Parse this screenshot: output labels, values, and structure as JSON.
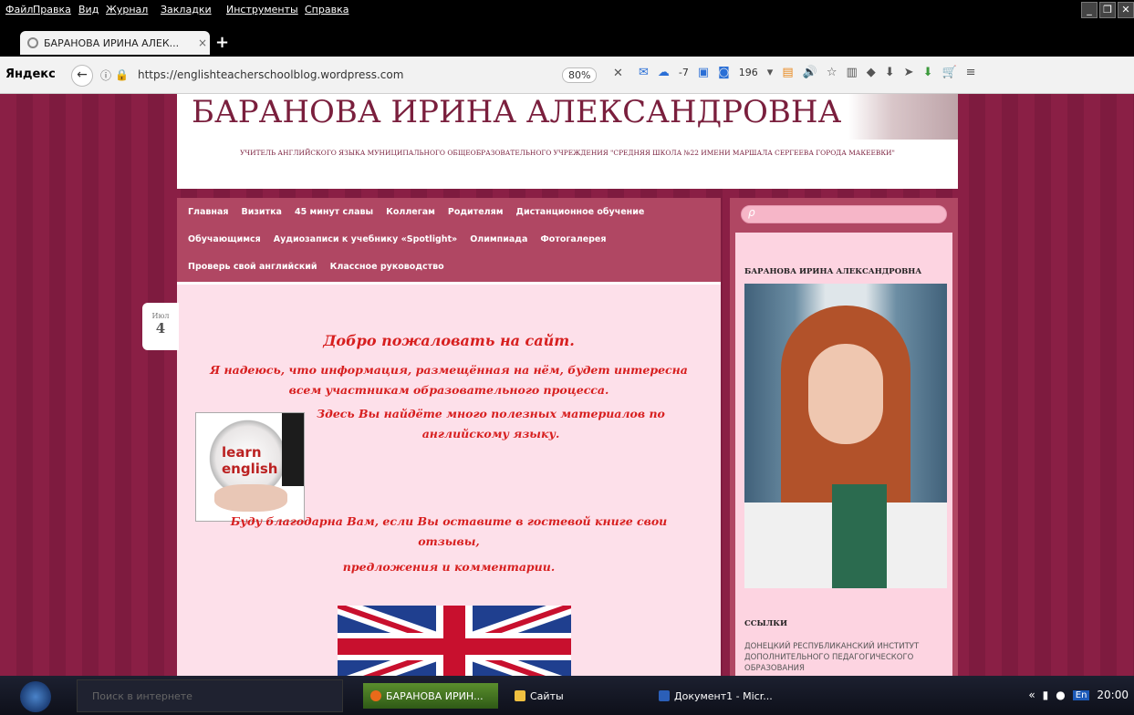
{
  "menubar": {
    "items": [
      "Файл",
      "Правка",
      "Вид",
      "Журнал",
      "Закладки",
      "Инструменты",
      "Справка"
    ]
  },
  "tab": {
    "title": "БАРАНОВА ИРИНА АЛЕК...",
    "close_label": "×",
    "new_tab_label": "+"
  },
  "navbar": {
    "brand": "Яндекс",
    "url": "https://englishteacherschoolblog.wordpress.com",
    "zoom": "80%",
    "weather": "-7",
    "counter": "196"
  },
  "site": {
    "title": "БАРАНОВА ИРИНА АЛЕКСАНДРОВНА",
    "description": "УЧИТЕЛЬ АНГЛИЙСКОГО ЯЗЫКА МУНИЦИПАЛЬНОГО ОБЩЕОБРАЗОВАТЕЛЬНОГО УЧРЕЖДЕНИЯ \"СРЕДНЯЯ ШКОЛА №22 ИМЕНИ МАРШАЛА СЕРГЕЕВА ГОРОДА МАКЕЕВКИ\"",
    "nav_row1": [
      "Главная",
      "Визитка",
      "45 минут славы",
      "Коллегам",
      "Родителям",
      "Дистанционное обучение"
    ],
    "nav_row2": [
      "Обучающимся",
      "Аудиозаписи к учебнику «Spotlight»",
      "Олимпиада",
      "Фотогалерея"
    ],
    "nav_row3": [
      "Проверь свой английский",
      "Классное руководство"
    ]
  },
  "post": {
    "date_month": "Июл",
    "date_day": "4",
    "welcome": "Добро пожаловать на сайт.",
    "line1": "Я надеюсь, что информация, размещённая на нём, будет интересна",
    "line2": "всем участникам образовательного процесса.",
    "line3": "Здесь Вы найдёте много полезных материалов по",
    "line4": "английскому языку.",
    "line5": "Буду благодарна Вам, если Вы оставите в гостевой книге свои",
    "line6": "отзывы,",
    "line7": "предложения и комментарии.",
    "globe_text": "learn english"
  },
  "sidebar": {
    "profile_heading": "БАРАНОВА ИРИНА АЛЕКСАНДРОВНА",
    "links_heading": "ССЫЛКИ",
    "link1": "ДОНЕЦКИЙ РЕСПУБЛИКАНСКИЙ ИНСТИТУТ ДОПОЛНИТЕЛЬНОГО ПЕДАГОГИЧЕСКОГО ОБРАЗОВАНИЯ"
  },
  "taskbar": {
    "search_placeholder": "Поиск в интернете",
    "task1": "БАРАНОВА ИРИН...",
    "task2": "Сайты",
    "task3": "Документ1 - Micr...",
    "lang": "En",
    "time": "20:00"
  },
  "colors": {
    "accent": "#b04763",
    "page_bg": "#8a1f45",
    "title": "#7a1f3d",
    "post_text": "#d71f1f"
  }
}
